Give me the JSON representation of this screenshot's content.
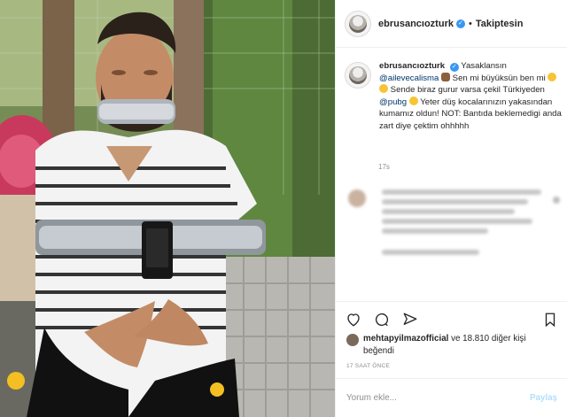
{
  "header": {
    "username": "ebrusancıozturk",
    "verified_mark": "✓",
    "separator": "•",
    "follow_label": "Takiptesin"
  },
  "caption": {
    "username": "ebrusancıozturk",
    "verified_mark": "✓",
    "part1": "Yasaklansın ",
    "mention1": "@ailevecalisma",
    "part2": "Sen mi büyüksün ben mi ",
    "part3": "Sende biraz gurur varsa çekil Türkiyeden ",
    "mention2": "@pubg",
    "part4": "Yeter düş kocalarınızın yakasından kumamız oldun! NOT: Bantıda beklemedigi anda zart diye çektim ohhhhh",
    "time": "17s"
  },
  "likes": {
    "user": "mehtapyilmazofficial",
    "rest": " ve 18.810 diğer kişi",
    "suffix": "beğendi"
  },
  "post_time": "17 SAAT ÖNCE",
  "comment": {
    "placeholder": "Yorum ekle...",
    "post_label": "Paylaş"
  },
  "icons": {
    "like": "heart-icon",
    "comment": "comment-icon",
    "share": "send-icon",
    "save": "bookmark-icon"
  },
  "colors": {
    "verified": "#3897f0",
    "mention": "#00376b",
    "muted": "#8e8e8e",
    "post_button": "#b2dffc"
  }
}
